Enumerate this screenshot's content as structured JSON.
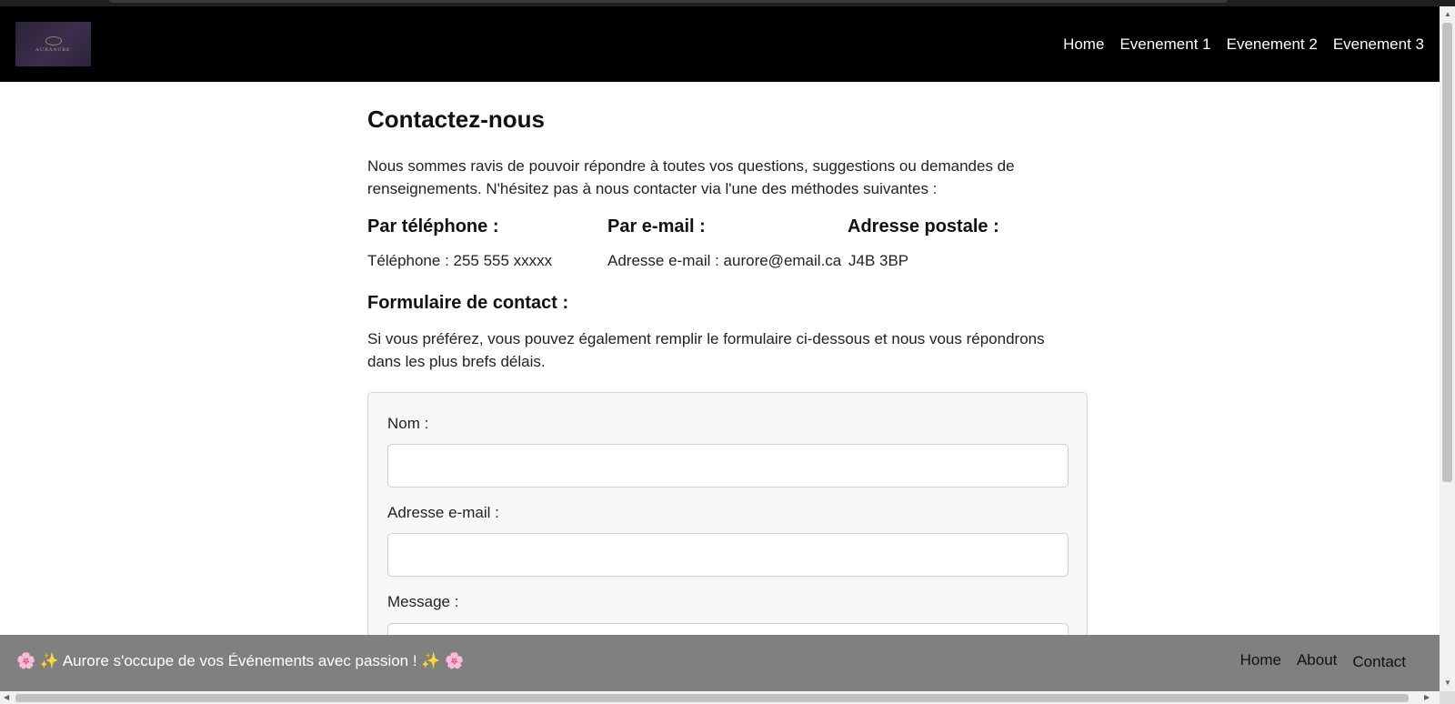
{
  "logo": {
    "text": "AURAAURE"
  },
  "nav": {
    "items": [
      "Home",
      "Evenement 1",
      "Evenement 2",
      "Evenement 3"
    ]
  },
  "main": {
    "title": "Contactez-nous",
    "intro": "Nous sommes ravis de pouvoir répondre à toutes vos questions, suggestions ou demandes de renseignements. N'hésitez pas à nous contacter via l'une des méthodes suivantes :",
    "contact_methods": [
      {
        "heading": "Par téléphone :",
        "text": "Téléphone : 255 555 xxxxx"
      },
      {
        "heading": "Par e-mail :",
        "text": "Adresse e-mail : aurore@email.ca"
      },
      {
        "heading": "Adresse postale :",
        "text": "J4B 3BP"
      }
    ],
    "form_heading": "Formulaire de contact :",
    "form_intro": "Si vous préférez, vous pouvez également remplir le formulaire ci-dessous et nous vous répondrons dans les plus brefs délais.",
    "form": {
      "name_label": "Nom :",
      "email_label": "Adresse e-mail :",
      "message_label": "Message :"
    }
  },
  "footer": {
    "tagline": "🌸 ✨ Aurore s'occupe de vos Événements avec passion ! ✨ 🌸",
    "links": [
      "Home",
      "About",
      "Contact"
    ]
  },
  "scrollbar": {
    "up": "▲",
    "down": "▼",
    "left": "◀",
    "right": "▶"
  }
}
